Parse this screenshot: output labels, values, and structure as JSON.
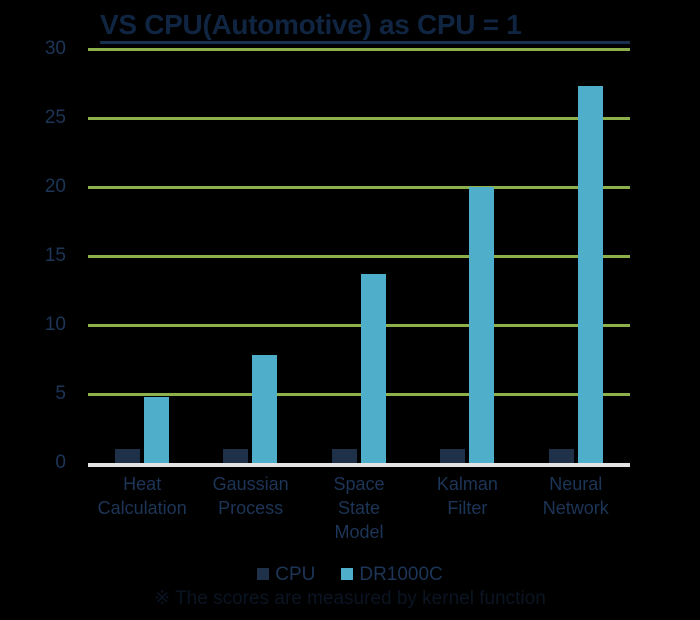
{
  "chart_data": {
    "type": "bar",
    "title": "VS CPU(Automotive) as CPU = 1",
    "xlabel": "",
    "ylabel": "",
    "ylim": [
      0,
      30
    ],
    "yticks": [
      0,
      5,
      10,
      15,
      20,
      25,
      30
    ],
    "grid": true,
    "legend_position": "bottom",
    "categories": [
      "Heat Calculation",
      "Gaussian Process",
      "Space State Model",
      "Kalman Filter",
      "Neural Network"
    ],
    "category_lines": [
      [
        "Heat",
        "Calculation"
      ],
      [
        "Gaussian",
        "Process"
      ],
      [
        "Space",
        "State",
        "Model"
      ],
      [
        "Kalman",
        "Filter"
      ],
      [
        "Neural",
        "Network"
      ]
    ],
    "series": [
      {
        "name": "CPU",
        "color": "#1E3149",
        "values": [
          1,
          1,
          1,
          1,
          1
        ]
      },
      {
        "name": "DR1000C",
        "color": "#4FAFCB",
        "values": [
          4.8,
          7.8,
          13.7,
          20.0,
          27.3
        ]
      }
    ],
    "annotation": "※ The scores are measured by kernel function"
  },
  "colors": {
    "background": "#000000",
    "gridline": "#8DB14A",
    "axis_line": "#e3e3e3",
    "title_text": "#102542",
    "tick_text": "#1d3557",
    "series_cpu": "#1E3149",
    "series_dr1000c": "#4FAFCB",
    "footnote_text": "#0a1422"
  }
}
